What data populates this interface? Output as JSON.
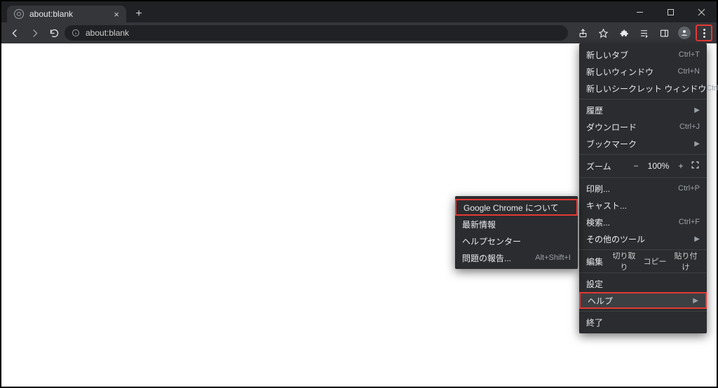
{
  "tab": {
    "title": "about:blank"
  },
  "url": "about:blank",
  "menu": {
    "new_tab": {
      "label": "新しいタブ",
      "shortcut": "Ctrl+T"
    },
    "new_window": {
      "label": "新しいウィンドウ",
      "shortcut": "Ctrl+N"
    },
    "new_incognito": {
      "label": "新しいシークレット ウィンドウ",
      "shortcut": "Ctrl+Shift+N"
    },
    "history": {
      "label": "履歴"
    },
    "downloads": {
      "label": "ダウンロード",
      "shortcut": "Ctrl+J"
    },
    "bookmarks": {
      "label": "ブックマーク"
    },
    "zoom": {
      "label": "ズーム",
      "minus": "−",
      "value": "100%",
      "plus": "+"
    },
    "print": {
      "label": "印刷...",
      "shortcut": "Ctrl+P"
    },
    "cast": {
      "label": "キャスト..."
    },
    "find": {
      "label": "検索...",
      "shortcut": "Ctrl+F"
    },
    "more_tools": {
      "label": "その他のツール"
    },
    "edit": {
      "label": "編集",
      "cut": "切り取り",
      "copy": "コピー",
      "paste": "貼り付け"
    },
    "settings": {
      "label": "設定"
    },
    "help": {
      "label": "ヘルプ"
    },
    "exit": {
      "label": "終了"
    }
  },
  "help_submenu": {
    "about": {
      "label": "Google Chrome について"
    },
    "whats_new": {
      "label": "最新情報"
    },
    "help_center": {
      "label": "ヘルプセンター"
    },
    "report": {
      "label": "問題の報告...",
      "shortcut": "Alt+Shift+I"
    }
  }
}
